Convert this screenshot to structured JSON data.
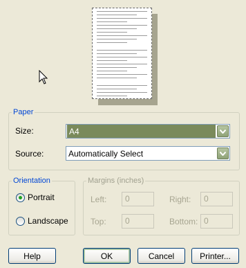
{
  "paper": {
    "legend": "Paper",
    "size_label": "Size:",
    "size_value": "A4",
    "source_label": "Source:",
    "source_value": "Automatically Select"
  },
  "orientation": {
    "legend": "Orientation",
    "portrait_label": "Portrait",
    "landscape_label": "Landscape",
    "selected": "portrait"
  },
  "margins": {
    "legend": "Margins (inches)",
    "left_label": "Left:",
    "left_value": "0",
    "right_label": "Right:",
    "right_value": "0",
    "top_label": "Top:",
    "top_value": "0",
    "bottom_label": "Bottom:",
    "bottom_value": "0"
  },
  "buttons": {
    "help": "Help",
    "ok": "OK",
    "cancel": "Cancel",
    "printer": "Printer..."
  },
  "colors": {
    "dialog_bg": "#ECE9D8",
    "group_title": "#0046D5",
    "selected_combo": "#7A8A5B"
  }
}
